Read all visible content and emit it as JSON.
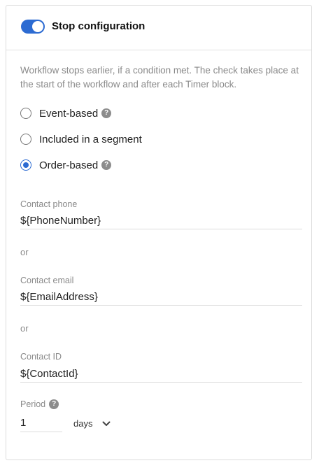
{
  "header": {
    "toggle_on": true,
    "title": "Stop configuration"
  },
  "description": "Workflow stops earlier, if a condition met. The check takes place at the start of the workflow and after each Timer block.",
  "conditions": [
    {
      "label": "Event-based",
      "has_help": true,
      "checked": false
    },
    {
      "label": "Included in a segment",
      "has_help": false,
      "checked": false
    },
    {
      "label": "Order-based",
      "has_help": true,
      "checked": true
    }
  ],
  "fields": {
    "phone": {
      "label": "Contact phone",
      "value": "${PhoneNumber}"
    },
    "or1": "or",
    "email": {
      "label": "Contact email",
      "value": "${EmailAddress}"
    },
    "or2": "or",
    "contact_id": {
      "label": "Contact ID",
      "value": "${ContactId}"
    }
  },
  "period": {
    "label": "Period",
    "value": "1",
    "unit": "days"
  },
  "icons": {
    "help": "help-icon",
    "chevron": "chevron-down-icon"
  },
  "colors": {
    "accent": "#2c6bd2",
    "muted_text": "#8a8a8a",
    "border": "#dcdcdc"
  }
}
